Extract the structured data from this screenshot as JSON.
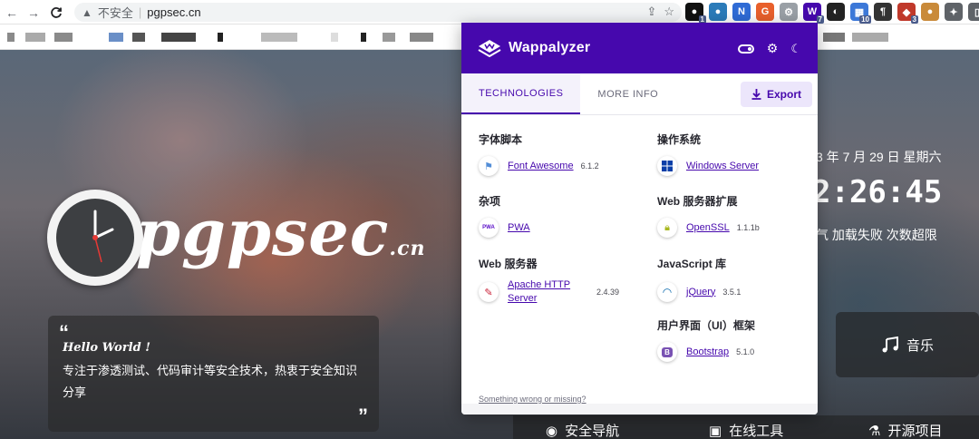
{
  "browser": {
    "back": "←",
    "forward": "→",
    "reload": "C",
    "security_warning": "不安全",
    "separator": "|",
    "url": "pgpsec.cn",
    "share_icon": "share-icon",
    "star_icon": "star-icon",
    "extensions": [
      {
        "name": "ext-octocat",
        "glyph": "●",
        "color": "#111111",
        "badge": "1"
      },
      {
        "name": "ext-globe",
        "glyph": "●",
        "color": "#2b7bb9",
        "badge": ""
      },
      {
        "name": "ext-n",
        "glyph": "N",
        "color": "#2f6bd5",
        "badge": ""
      },
      {
        "name": "ext-go",
        "glyph": "G",
        "color": "#e8602c",
        "badge": ""
      },
      {
        "name": "ext-gray",
        "glyph": "⚙",
        "color": "#9aa0a6",
        "badge": ""
      },
      {
        "name": "ext-wappalyzer",
        "glyph": "W",
        "color": "#4608ad",
        "badge": "7"
      },
      {
        "name": "ext-mask",
        "glyph": "◐",
        "color": "#222222",
        "badge": ""
      },
      {
        "name": "ext-blue",
        "glyph": "▦",
        "color": "#3c78d8",
        "badge": "10"
      },
      {
        "name": "ext-para",
        "glyph": "¶",
        "color": "#333333",
        "badge": ""
      },
      {
        "name": "ext-shield",
        "glyph": "◆",
        "color": "#c0392b",
        "badge": "3"
      },
      {
        "name": "ext-cookie",
        "glyph": "●",
        "color": "#c98a3a",
        "badge": ""
      },
      {
        "name": "ext-puzzle",
        "glyph": "✦",
        "color": "#5f6368",
        "badge": ""
      },
      {
        "name": "ext-sidepanel",
        "glyph": "▯",
        "color": "#5f6368",
        "badge": ""
      }
    ]
  },
  "page": {
    "logo_text": "pgpsec",
    "logo_suffix": ".cn",
    "hello": "Hello World !",
    "description": "专注于渗透测试、代码审计等安全技术，热衷于安全知识分享",
    "date": "3 年 7 月 29 日 星期六",
    "time": "2:26:45",
    "weather": "气 加载失败 次数超限",
    "music_label": "音乐",
    "nav": [
      "安全导航",
      "在线工具",
      "开源项目"
    ]
  },
  "wappalyzer": {
    "title": "Wappalyzer",
    "tabs": [
      "TECHNOLOGIES",
      "MORE INFO"
    ],
    "export_label": "Export",
    "categories": [
      {
        "title": "字体脚本",
        "items": [
          {
            "name": "Font Awesome",
            "version": "6.1.2",
            "icon": "font-awesome-icon"
          }
        ]
      },
      {
        "title": "操作系统",
        "items": [
          {
            "name": "Windows Server",
            "version": "",
            "icon": "windows-icon"
          }
        ]
      },
      {
        "title": "杂项",
        "items": [
          {
            "name": "PWA",
            "version": "",
            "icon": "pwa-icon"
          }
        ]
      },
      {
        "title": "Web 服务器扩展",
        "items": [
          {
            "name": "OpenSSL",
            "version": "1.1.1b",
            "icon": "openssl-icon"
          }
        ]
      },
      {
        "title": "Web 服务器",
        "items": [
          {
            "name": "Apache HTTP Server",
            "version": "2.4.39",
            "icon": "apache-icon"
          }
        ]
      },
      {
        "title": "JavaScript 库",
        "items": [
          {
            "name": "jQuery",
            "version": "3.5.1",
            "icon": "jquery-icon"
          }
        ]
      },
      {
        "title": "用户界面（UI）框架",
        "items": [
          {
            "name": "Bootstrap",
            "version": "5.1.0",
            "icon": "bootstrap-icon"
          }
        ]
      }
    ],
    "footer_link": "Something wrong or missing?"
  }
}
